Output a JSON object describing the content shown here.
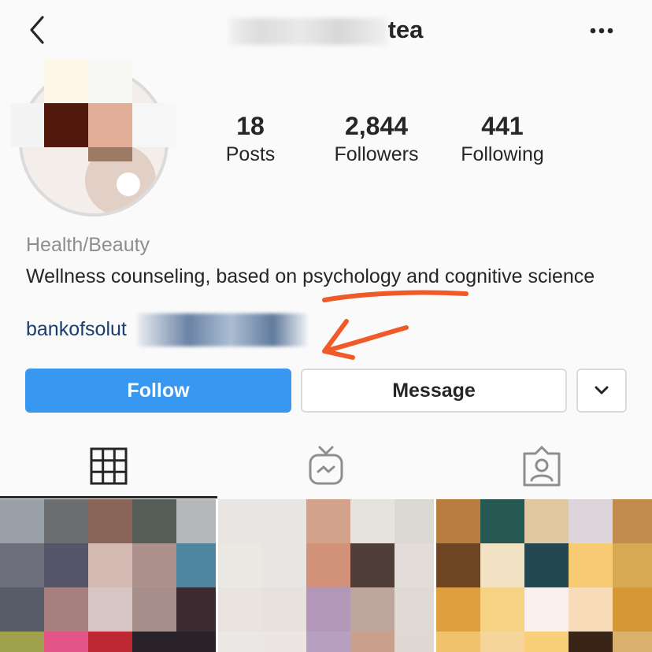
{
  "header": {
    "username_visible": "tea",
    "icons": {
      "back": "chevron-left-icon",
      "more": "more-horizontal-icon"
    }
  },
  "profile": {
    "stats": [
      {
        "value": "18",
        "label": "Posts"
      },
      {
        "value": "2,844",
        "label": "Followers"
      },
      {
        "value": "441",
        "label": "Following"
      }
    ],
    "category": "Health/Beauty",
    "bio": "Wellness counseling, based on psychology and cognitive science",
    "link_visible": "bankofsolut"
  },
  "actions": {
    "follow_label": "Follow",
    "message_label": "Message",
    "dropdown_icon": "chevron-down-icon"
  },
  "tabs": [
    {
      "icon": "grid-icon",
      "active": true
    },
    {
      "icon": "igtv-icon",
      "active": false
    },
    {
      "icon": "tagged-person-icon",
      "active": false
    }
  ],
  "colors": {
    "accent": "#3897f0",
    "text": "#262626",
    "muted": "#8e8e8e",
    "link": "#1a3c6e",
    "annotation": "#f05a28"
  }
}
